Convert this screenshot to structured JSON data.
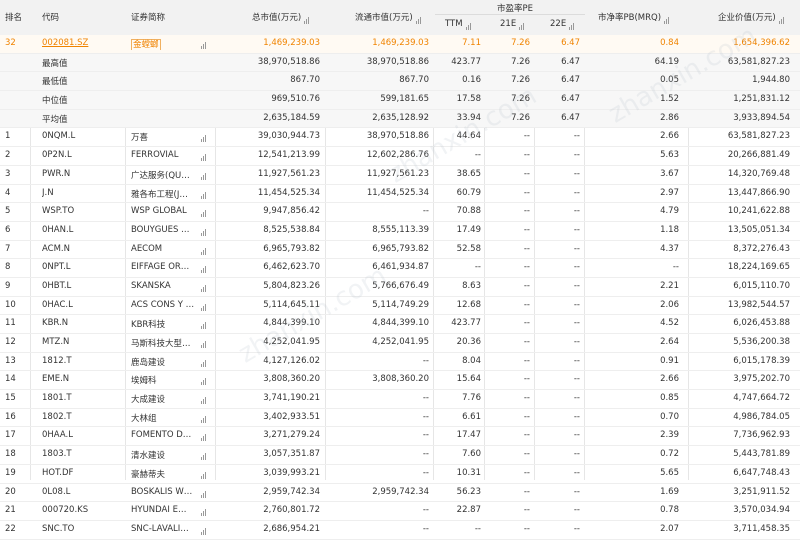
{
  "header": {
    "rank": "排名",
    "code": "代码",
    "name": "证券简称",
    "total_mv": "总市值(万元)",
    "circ_mv": "流通市值(万元)",
    "pe_group": "市盈率PE",
    "ttm": "TTM",
    "e21": "21E",
    "e22": "22E",
    "pb": "市净率PB(MRQ)",
    "ev": "企业价值(万元)"
  },
  "self_row": {
    "rank": "32",
    "code": "002081.SZ",
    "name": "金螳螂",
    "total_mv": "1,469,239.03",
    "circ_mv": "1,469,239.03",
    "ttm": "7.11",
    "e21": "7.26",
    "e22": "6.47",
    "pb": "0.84",
    "ev": "1,654,396.62"
  },
  "stats": [
    {
      "label": "最高值",
      "total_mv": "38,970,518.86",
      "circ_mv": "38,970,518.86",
      "ttm": "423.77",
      "e21": "7.26",
      "e22": "6.47",
      "pb": "64.19",
      "ev": "63,581,827.23"
    },
    {
      "label": "最低值",
      "total_mv": "867.70",
      "circ_mv": "867.70",
      "ttm": "0.16",
      "e21": "7.26",
      "e22": "6.47",
      "pb": "0.05",
      "ev": "1,944.80"
    },
    {
      "label": "中位值",
      "total_mv": "969,510.76",
      "circ_mv": "599,181.65",
      "ttm": "17.58",
      "e21": "7.26",
      "e22": "6.47",
      "pb": "1.52",
      "ev": "1,251,831.12"
    },
    {
      "label": "平均值",
      "total_mv": "2,635,184.59",
      "circ_mv": "2,635,128.92",
      "ttm": "33.94",
      "e21": "7.26",
      "e22": "6.47",
      "pb": "2.86",
      "ev": "3,933,894.54"
    }
  ],
  "rows": [
    {
      "rank": "1",
      "code": "0NQM.L",
      "name": "万喜",
      "total_mv": "39,030,944.73",
      "circ_mv": "38,970,518.86",
      "ttm": "44.64",
      "e21": "--",
      "e22": "--",
      "pb": "2.66",
      "ev": "63,581,827.23"
    },
    {
      "rank": "2",
      "code": "0P2N.L",
      "name": "FERROVIAL",
      "total_mv": "12,541,213.99",
      "circ_mv": "12,602,286.76",
      "ttm": "--",
      "e21": "--",
      "e22": "--",
      "pb": "5.63",
      "ev": "20,266,881.49"
    },
    {
      "rank": "3",
      "code": "PWR.N",
      "name": "广达服务(QU…",
      "total_mv": "11,927,561.23",
      "circ_mv": "11,927,561.23",
      "ttm": "38.65",
      "e21": "--",
      "e22": "--",
      "pb": "3.67",
      "ev": "14,320,769.48"
    },
    {
      "rank": "4",
      "code": "J.N",
      "name": "雅各布工程(J…",
      "total_mv": "11,454,525.34",
      "circ_mv": "11,454,525.34",
      "ttm": "60.79",
      "e21": "--",
      "e22": "--",
      "pb": "2.97",
      "ev": "13,447,866.90"
    },
    {
      "rank": "5",
      "code": "WSP.TO",
      "name": "WSP GLOBAL",
      "total_mv": "9,947,856.42",
      "circ_mv": "--",
      "ttm": "70.88",
      "e21": "--",
      "e22": "--",
      "pb": "4.79",
      "ev": "10,241,622.88"
    },
    {
      "rank": "6",
      "code": "0HAN.L",
      "name": "BOUYGUES …",
      "total_mv": "8,525,538.84",
      "circ_mv": "8,555,113.39",
      "ttm": "17.49",
      "e21": "--",
      "e22": "--",
      "pb": "1.18",
      "ev": "13,505,051.34"
    },
    {
      "rank": "7",
      "code": "ACM.N",
      "name": "AECOM",
      "total_mv": "6,965,793.82",
      "circ_mv": "6,965,793.82",
      "ttm": "52.58",
      "e21": "--",
      "e22": "--",
      "pb": "4.37",
      "ev": "8,372,276.43"
    },
    {
      "rank": "8",
      "code": "0NPT.L",
      "name": "EIFFAGE OR…",
      "total_mv": "6,462,623.70",
      "circ_mv": "6,461,934.87",
      "ttm": "--",
      "e21": "--",
      "e22": "--",
      "pb": "--",
      "ev": "18,224,169.65"
    },
    {
      "rank": "9",
      "code": "0HBT.L",
      "name": "SKANSKA",
      "total_mv": "5,804,823.26",
      "circ_mv": "5,766,676.49",
      "ttm": "8.63",
      "e21": "--",
      "e22": "--",
      "pb": "2.21",
      "ev": "6,015,110.70"
    },
    {
      "rank": "10",
      "code": "0HAC.L",
      "name": "ACS CONS Y …",
      "total_mv": "5,114,645.11",
      "circ_mv": "5,114,749.29",
      "ttm": "12.68",
      "e21": "--",
      "e22": "--",
      "pb": "2.06",
      "ev": "13,982,544.57"
    },
    {
      "rank": "11",
      "code": "KBR.N",
      "name": "KBR科技",
      "total_mv": "4,844,399.10",
      "circ_mv": "4,844,399.10",
      "ttm": "423.77",
      "e21": "--",
      "e22": "--",
      "pb": "4.52",
      "ev": "6,026,453.88"
    },
    {
      "rank": "12",
      "code": "MTZ.N",
      "name": "马斯科技大型…",
      "total_mv": "4,252,041.95",
      "circ_mv": "4,252,041.95",
      "ttm": "20.36",
      "e21": "--",
      "e22": "--",
      "pb": "2.64",
      "ev": "5,536,200.38"
    },
    {
      "rank": "13",
      "code": "1812.T",
      "name": "鹿岛建设",
      "total_mv": "4,127,126.02",
      "circ_mv": "--",
      "ttm": "8.04",
      "e21": "--",
      "e22": "--",
      "pb": "0.91",
      "ev": "6,015,178.39"
    },
    {
      "rank": "14",
      "code": "EME.N",
      "name": "埃姆科",
      "total_mv": "3,808,360.20",
      "circ_mv": "3,808,360.20",
      "ttm": "15.64",
      "e21": "--",
      "e22": "--",
      "pb": "2.66",
      "ev": "3,975,202.70"
    },
    {
      "rank": "15",
      "code": "1801.T",
      "name": "大成建设",
      "total_mv": "3,741,190.21",
      "circ_mv": "--",
      "ttm": "7.76",
      "e21": "--",
      "e22": "--",
      "pb": "0.85",
      "ev": "4,747,664.72"
    },
    {
      "rank": "16",
      "code": "1802.T",
      "name": "大林组",
      "total_mv": "3,402,933.51",
      "circ_mv": "--",
      "ttm": "6.61",
      "e21": "--",
      "e22": "--",
      "pb": "0.70",
      "ev": "4,986,784.05"
    },
    {
      "rank": "17",
      "code": "0HAA.L",
      "name": "FOMENTO D…",
      "total_mv": "3,271,279.24",
      "circ_mv": "--",
      "ttm": "17.47",
      "e21": "--",
      "e22": "--",
      "pb": "2.39",
      "ev": "7,736,962.93"
    },
    {
      "rank": "18",
      "code": "1803.T",
      "name": "清水建设",
      "total_mv": "3,057,351.87",
      "circ_mv": "--",
      "ttm": "7.60",
      "e21": "--",
      "e22": "--",
      "pb": "0.72",
      "ev": "5,443,781.89"
    },
    {
      "rank": "19",
      "code": "HOT.DF",
      "name": "豪赫蒂夫",
      "total_mv": "3,039,993.21",
      "circ_mv": "--",
      "ttm": "10.31",
      "e21": "--",
      "e22": "--",
      "pb": "5.65",
      "ev": "6,647,748.43"
    },
    {
      "rank": "20",
      "code": "0L08.L",
      "name": "BOSKALIS W…",
      "total_mv": "2,959,742.34",
      "circ_mv": "2,959,742.34",
      "ttm": "56.23",
      "e21": "--",
      "e22": "--",
      "pb": "1.69",
      "ev": "3,251,911.52"
    },
    {
      "rank": "21",
      "code": "000720.KS",
      "name": "HYUNDAI E…",
      "total_mv": "2,760,801.72",
      "circ_mv": "--",
      "ttm": "22.87",
      "e21": "--",
      "e22": "--",
      "pb": "0.78",
      "ev": "3,570,034.94"
    },
    {
      "rank": "22",
      "code": "SNC.TO",
      "name": "SNC-LAVALI…",
      "total_mv": "2,686,954.21",
      "circ_mv": "--",
      "ttm": "--",
      "e21": "--",
      "e22": "--",
      "pb": "2.07",
      "ev": "3,711,458.35"
    }
  ]
}
